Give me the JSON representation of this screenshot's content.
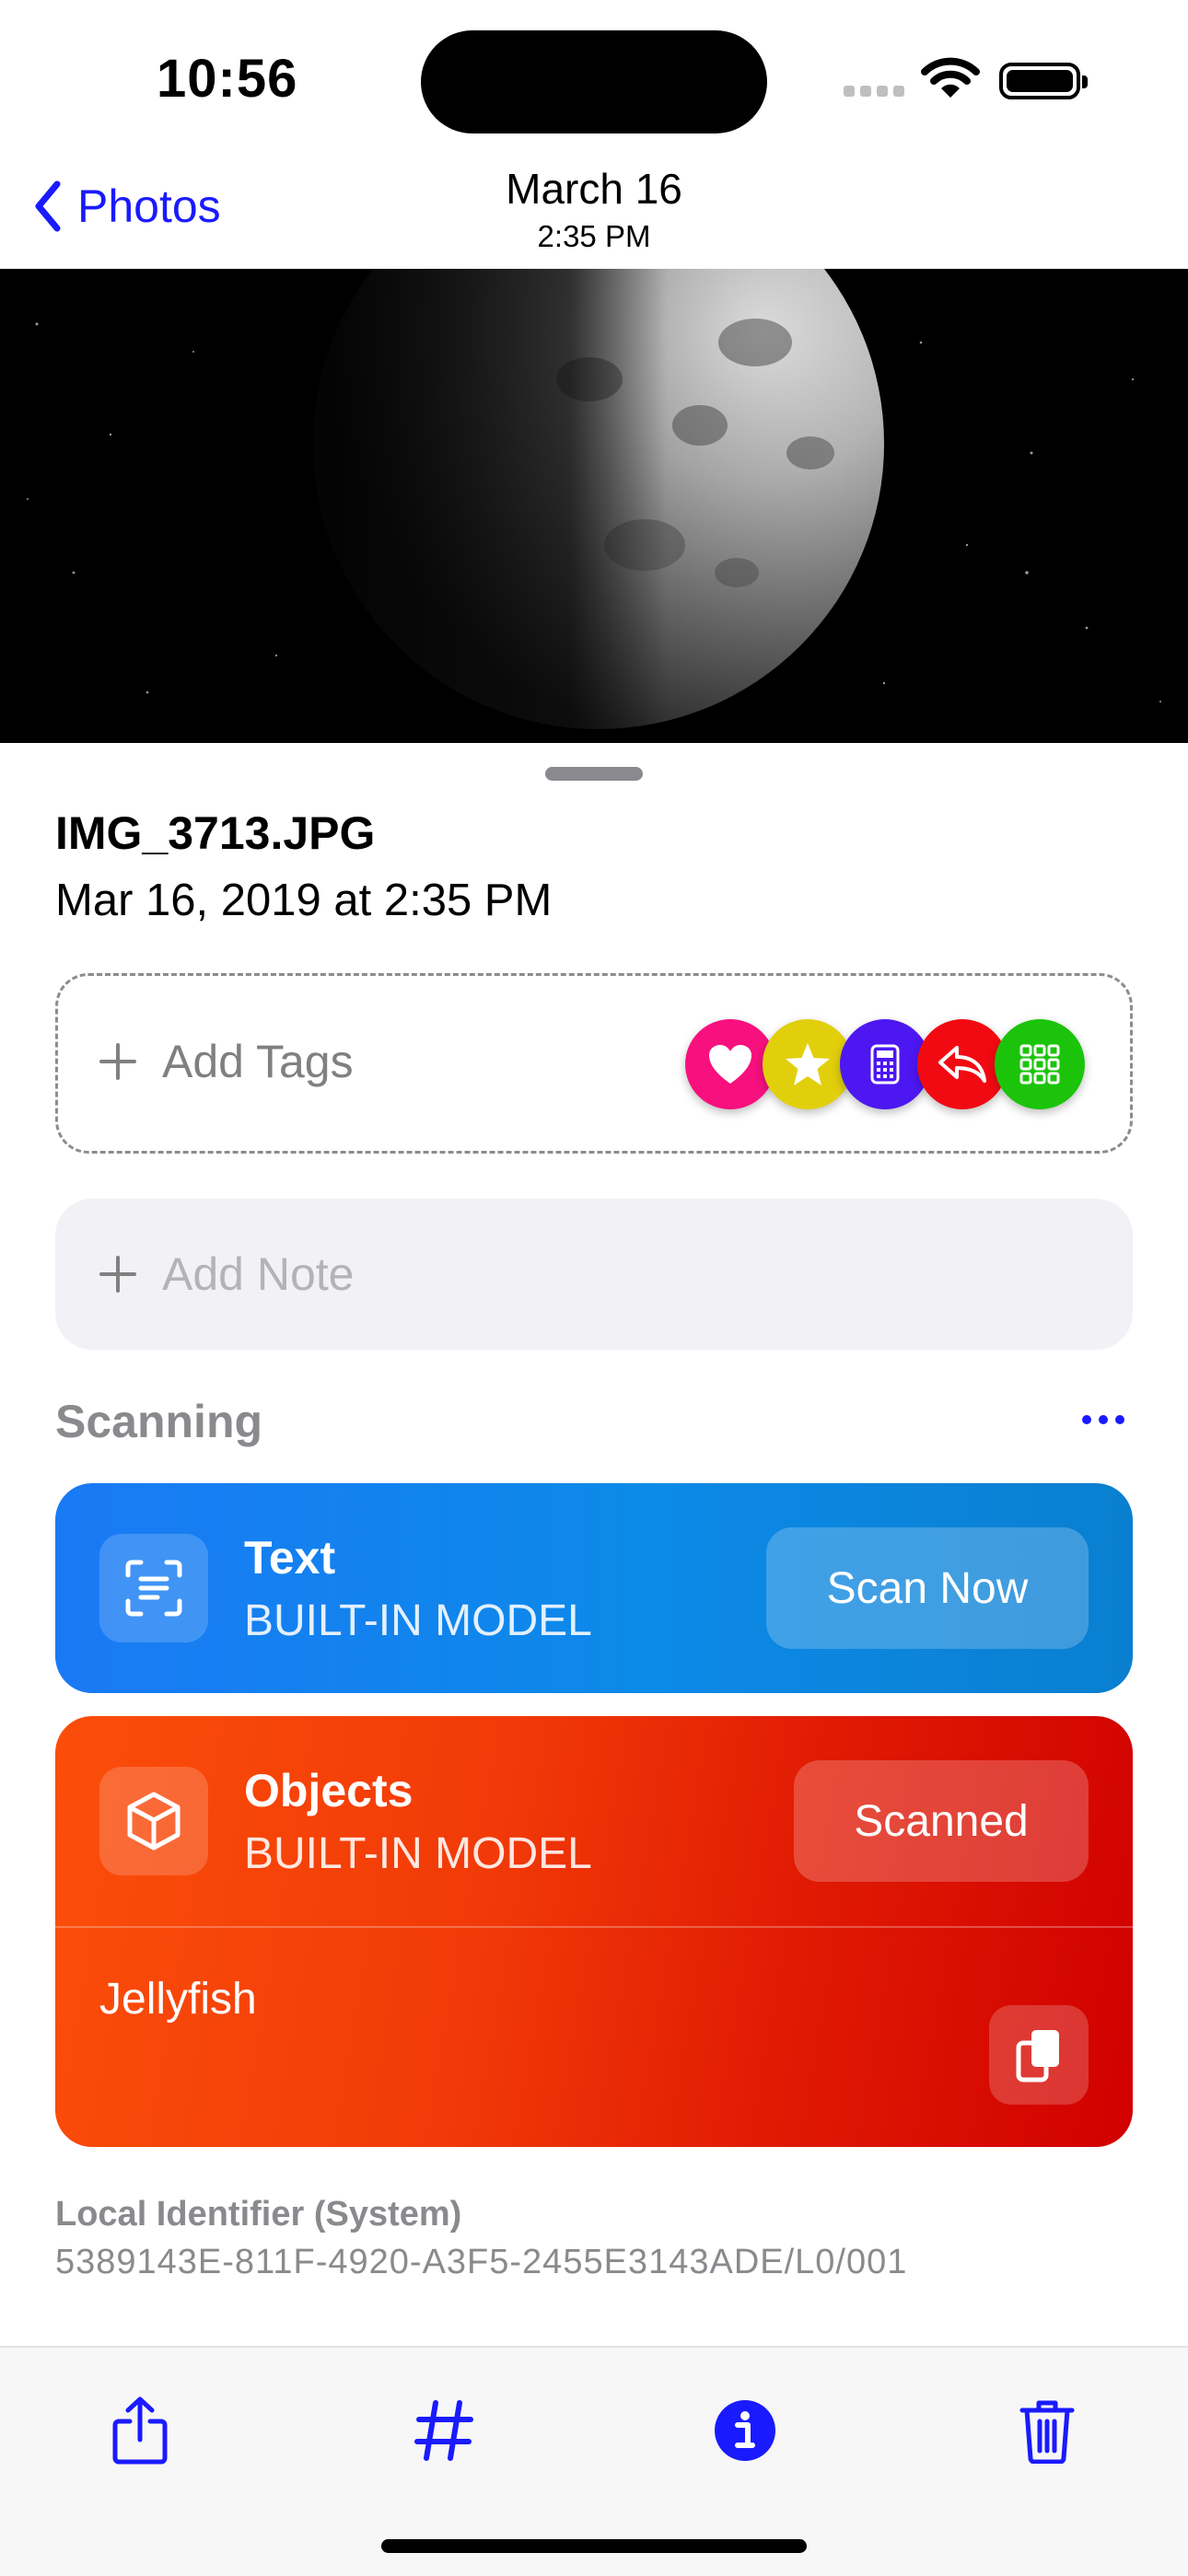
{
  "status_bar": {
    "time": "10:56"
  },
  "nav": {
    "back_label": "Photos",
    "title": "March 16",
    "subtitle": "2:35 PM"
  },
  "photo": {
    "description_icon": "moon-photo"
  },
  "file": {
    "name": "IMG_3713.JPG",
    "date": "Mar 16, 2019 at 2:35 PM"
  },
  "tags": {
    "add_label": "Add Tags",
    "quick_tags": [
      {
        "icon": "heart-icon",
        "color": "#f7107e"
      },
      {
        "icon": "star-icon",
        "color": "#e2cf0c"
      },
      {
        "icon": "calculator-icon",
        "color": "#4d17f2"
      },
      {
        "icon": "reply-icon",
        "color": "#f20a12"
      },
      {
        "icon": "grid-icon",
        "color": "#1bc40b"
      }
    ]
  },
  "note": {
    "add_label": "Add Note"
  },
  "scanning": {
    "section_label": "Scanning",
    "text_card": {
      "title": "Text",
      "subtitle": "BUILT-IN MODEL",
      "button": "Scan Now"
    },
    "objects_card": {
      "title": "Objects",
      "subtitle": "BUILT-IN MODEL",
      "button": "Scanned",
      "result": "Jellyfish"
    }
  },
  "identifier": {
    "label": "Local Identifier (System)",
    "value": "5389143E-811F-4920-A3F5-2455E3143ADE/L0/001"
  },
  "toolbar": {
    "items": [
      "share-icon",
      "hashtag-icon",
      "info-icon",
      "trash-icon"
    ]
  },
  "colors": {
    "accent": "#1a1aff",
    "text_card": "#1a7af5",
    "objects_card": "#f13a08"
  }
}
